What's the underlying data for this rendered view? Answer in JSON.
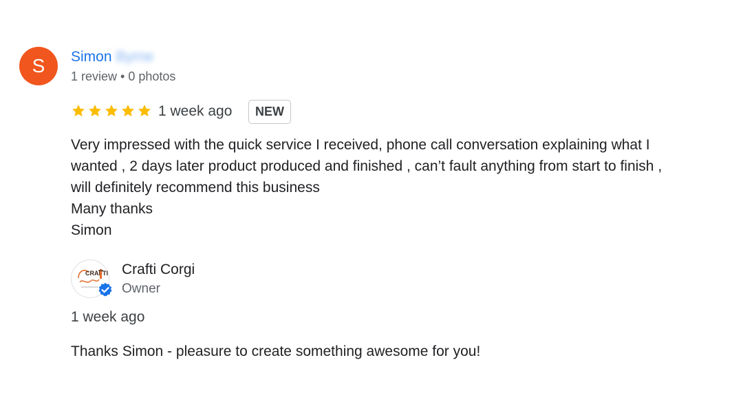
{
  "reviewer": {
    "initial": "S",
    "first_name": "Simon",
    "surname_redacted": "Byrne",
    "meta": "1 review • 0 photos"
  },
  "rating": {
    "stars": 5,
    "max": 5,
    "time": "1 week ago",
    "badge": "NEW",
    "star_color": "#fbbc04"
  },
  "review": {
    "lines": [
      "Very impressed with the quick service I received, phone call conversation explaining what I",
      "wanted , 2 days later product produced and finished , can’t fault anything from start to finish ,",
      "will definitely recommend this business",
      "Many thanks",
      "Simon"
    ]
  },
  "owner": {
    "logo_text": "CRAFTI",
    "name": "Crafti Corgi",
    "role": "Owner",
    "verified_icon": "verified-check-icon",
    "time": "1 week ago",
    "reply": "Thanks Simon - pleasure to create something awesome for you!"
  },
  "colors": {
    "avatar_bg": "#f0561d",
    "link": "#1a73e8",
    "verified": "#1a73e8",
    "logo_accent": "#e36b2c"
  }
}
